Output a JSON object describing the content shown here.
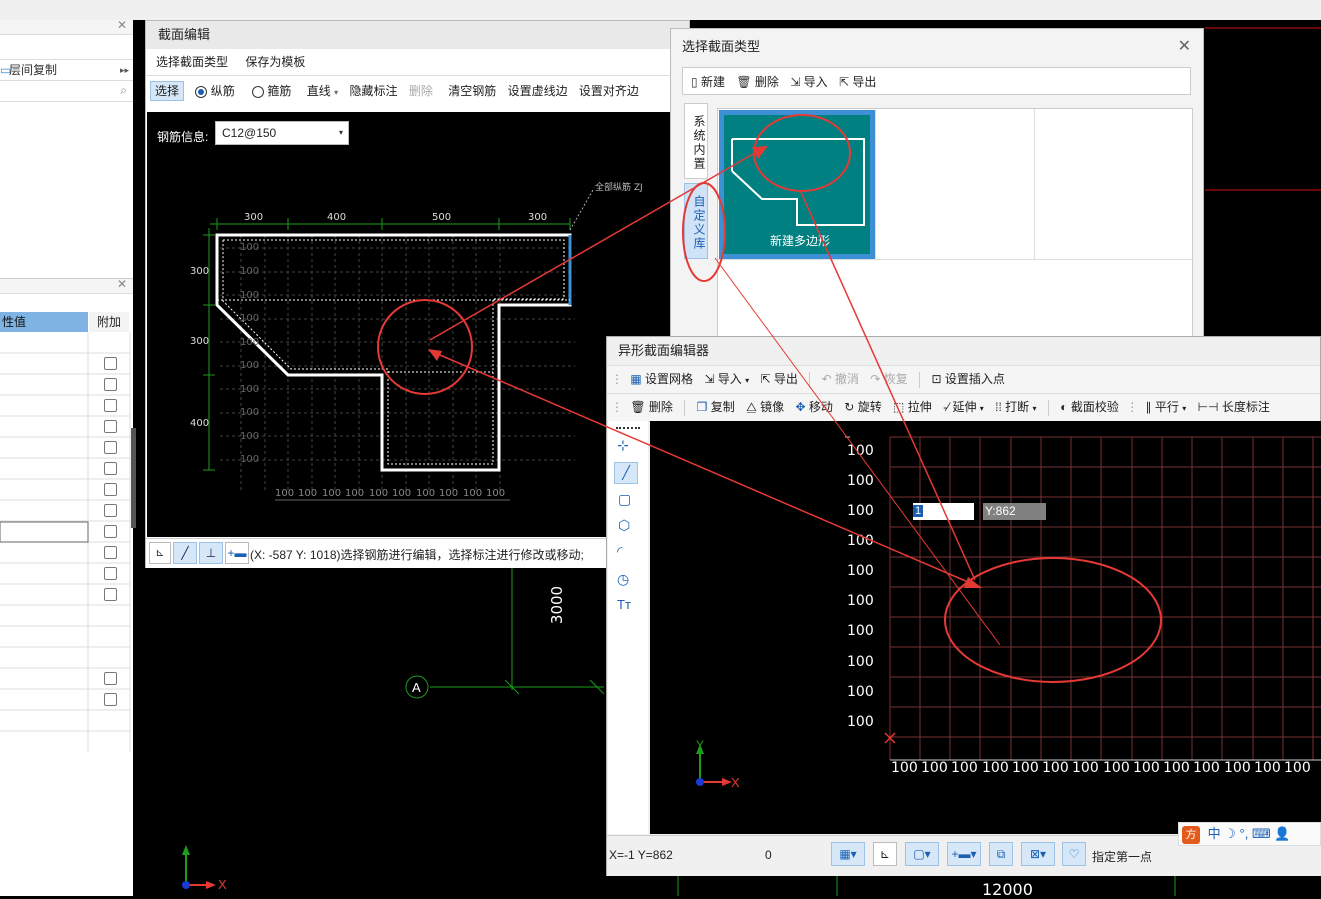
{
  "left_panel": {
    "floor_copy_label": "层间复制",
    "prop_header": "性值",
    "attach_header": "附加"
  },
  "section_editor": {
    "title": "截面编辑",
    "menu": [
      "选择截面类型",
      "保存为模板"
    ],
    "toolbar": {
      "select": "选择",
      "longitudinal": "纵筋",
      "stirrup": "箍筋",
      "line": "直线",
      "hide_dim": "隐藏标注",
      "delete": "删除",
      "clear_rebar": "清空钢筋",
      "set_dashed_edge": "设置虚线边",
      "set_align_edge": "设置对齐边"
    },
    "rebar_info_label": "钢筋信息:",
    "rebar_info_value": "C12@150",
    "annotation": "全部纵筋 ZJ",
    "top_dims": [
      "300",
      "400",
      "500",
      "300"
    ],
    "left_dims": [
      "300",
      "300",
      "400"
    ],
    "grid_label": "100",
    "status": "(X: -587 Y: 1018)选择钢筋进行编辑，选择标注进行修改或移动;"
  },
  "background": {
    "dim_3000": "3000",
    "dim_12000": "12000",
    "axis_a": "A",
    "x_label": "X",
    "y_label": "Y"
  },
  "select_type_dialog": {
    "title": "选择截面类型",
    "toolbar": {
      "new": "新建",
      "delete": "删除",
      "import": "导入",
      "export": "导出"
    },
    "tabs": [
      "系统内置",
      "自定义库"
    ],
    "tile_label": "新建多边形"
  },
  "irregular_editor": {
    "title": "异形截面编辑器",
    "toolbar1": {
      "set_grid": "设置网格",
      "import": "导入",
      "export": "导出",
      "undo": "撤消",
      "redo": "恢复",
      "set_insert_point": "设置插入点"
    },
    "toolbar2": {
      "delete": "删除",
      "copy": "复制",
      "mirror": "镜像",
      "move": "移动",
      "rotate": "旋转",
      "stretch": "拉伸",
      "extend": "延伸",
      "break": "打断",
      "section_check": "截面校验",
      "parallel": "平行",
      "length_dim": "长度标注"
    },
    "grid_label": "100",
    "coord_input_x": "1",
    "coord_input_y": "Y:862",
    "status_coords": "X=-1 Y=862",
    "status_zero": "0",
    "status_prompt": "指定第一点",
    "x_label": "X",
    "y_label": "Y"
  },
  "ime": {
    "lang": "中"
  },
  "colors": {
    "annotation_red": "#e53935",
    "teal_tile": "#008080",
    "accent_blue": "#3d8fd6"
  }
}
